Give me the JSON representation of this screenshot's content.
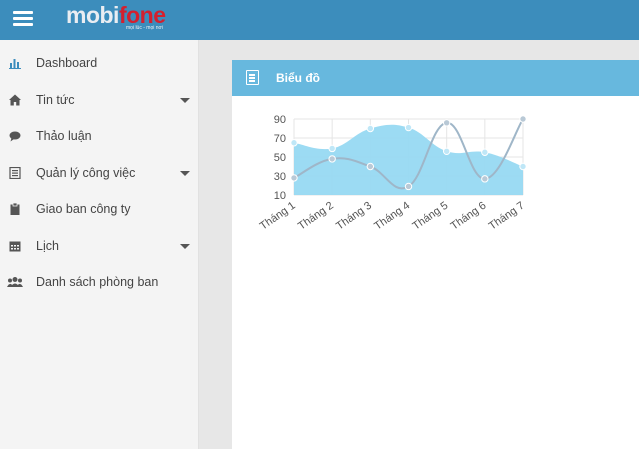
{
  "header": {
    "logo_part1": "mobi",
    "logo_part2": "fone",
    "logo_tagline": "mọi lúc - mọi nơi"
  },
  "sidebar": {
    "items": [
      {
        "label": "Dashboard",
        "icon": "bar-chart-icon",
        "has_caret": false
      },
      {
        "label": "Tin tức",
        "icon": "home-icon",
        "has_caret": true
      },
      {
        "label": "Thảo luận",
        "icon": "comment-icon",
        "has_caret": false
      },
      {
        "label": "Quản lý công việc",
        "icon": "list-icon",
        "has_caret": true
      },
      {
        "label": "Giao ban công ty",
        "icon": "clipboard-icon",
        "has_caret": false
      },
      {
        "label": "Lịch",
        "icon": "calendar-icon",
        "has_caret": true
      },
      {
        "label": "Danh sách phòng ban",
        "icon": "users-icon",
        "has_caret": false
      }
    ]
  },
  "panel": {
    "title": "Biểu đồ"
  },
  "colors": {
    "topbar": "#3c8dbc",
    "panel_header": "#67b8de",
    "area_fill": "#97d9f2",
    "line_series": "#9fb6c8",
    "logo_red": "#d4202e"
  },
  "chart_data": {
    "type": "area",
    "categories": [
      "Tháng 1",
      "Tháng 2",
      "Tháng 3",
      "Tháng 4",
      "Tháng 5",
      "Tháng 6",
      "Tháng 7"
    ],
    "series": [
      {
        "type": "area",
        "values": [
          65,
          59,
          80,
          81,
          56,
          55,
          40
        ]
      },
      {
        "type": "line",
        "values": [
          28,
          48,
          40,
          19,
          86,
          27,
          90
        ]
      }
    ],
    "yticks": [
      10,
      30,
      50,
      70,
      90
    ],
    "ylim": [
      10,
      90
    ],
    "grid": true
  }
}
